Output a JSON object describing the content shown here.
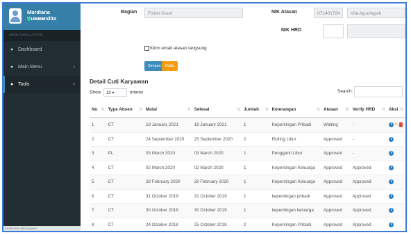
{
  "sidebar": {
    "user_name": "Mardiana Kuswandita",
    "status": "Online",
    "nav_header": "MAIN NAVIGATION",
    "items": [
      {
        "label": "Dashboard",
        "icon": "dashboard-icon"
      },
      {
        "label": "Main Menu",
        "icon": "circle-icon"
      },
      {
        "label": "Tools",
        "icon": "circle-icon"
      }
    ],
    "statusbar": "localhost/cutiKaryawan"
  },
  "form": {
    "bagian_label": "Bagian",
    "bagian_value": "Finish Good",
    "nik_atasan_label": "NIK Atasan",
    "nik_atasan_value": "071401724",
    "atasan_name_value": "Vita Ayuningsih",
    "nik_hrd_label": "NIK HRD",
    "nik_hrd_value": "",
    "hrd_name_value": "",
    "checkbox_label": "Kirim email atasan langsung",
    "save_label": "Simpan",
    "cancel_label": "Batal"
  },
  "table_section": {
    "title": "Detail Cuti Karyawan",
    "show_label": "Show",
    "entries_value": "10",
    "entries_label": "entries",
    "search_label": "Search:"
  },
  "table": {
    "headers": [
      "No",
      "Type Absen",
      "Mulai",
      "Selesai",
      "Jumlah",
      "Keterangan",
      "Atasan",
      "Verify HRD",
      "Aksi"
    ],
    "rows": [
      [
        "1",
        "CT",
        "18 January 2021",
        "18 January 2021",
        "1",
        "Kepentingan Pribadi",
        "Waiting",
        "-"
      ],
      [
        "2",
        "CT",
        "24 September 2020",
        "25 September 2020",
        "2",
        "Rolling Libur",
        "Approved",
        "-"
      ],
      [
        "3",
        "PL",
        "03 March 2020",
        "03 March 2020",
        "1",
        "Pengganti Libur",
        "Approved",
        "-"
      ],
      [
        "4",
        "CT",
        "02 March 2020",
        "02 March 2020",
        "1",
        "Kepentingan Keluarga",
        "Approved",
        "Approved"
      ],
      [
        "5",
        "CT",
        "28 February 2020",
        "28 February 2020",
        "1",
        "Kepentingan Keluarga",
        "Approved",
        "Approved"
      ],
      [
        "6",
        "CT",
        "31 October 2019",
        "31 October 2019",
        "1",
        "kepentingan pribadi",
        "Approved",
        "Approved"
      ],
      [
        "7",
        "CT",
        "30 October 2019",
        "30 October 2019",
        "1",
        "kepentingan keluarga",
        "Approved",
        "Approved"
      ],
      [
        "8",
        "CT",
        "24 October 2018",
        "25 October 2018",
        "2",
        "Kepentingan Pribadi",
        "Approved",
        "Approved"
      ]
    ]
  },
  "colors": {
    "sidebar_bg": "#222d32",
    "user_panel_bg": "#367fa9",
    "primary": "#3c8dbc",
    "warning": "#f39c12",
    "danger": "#dd4b39",
    "frame_border": "#3b7bd8"
  }
}
